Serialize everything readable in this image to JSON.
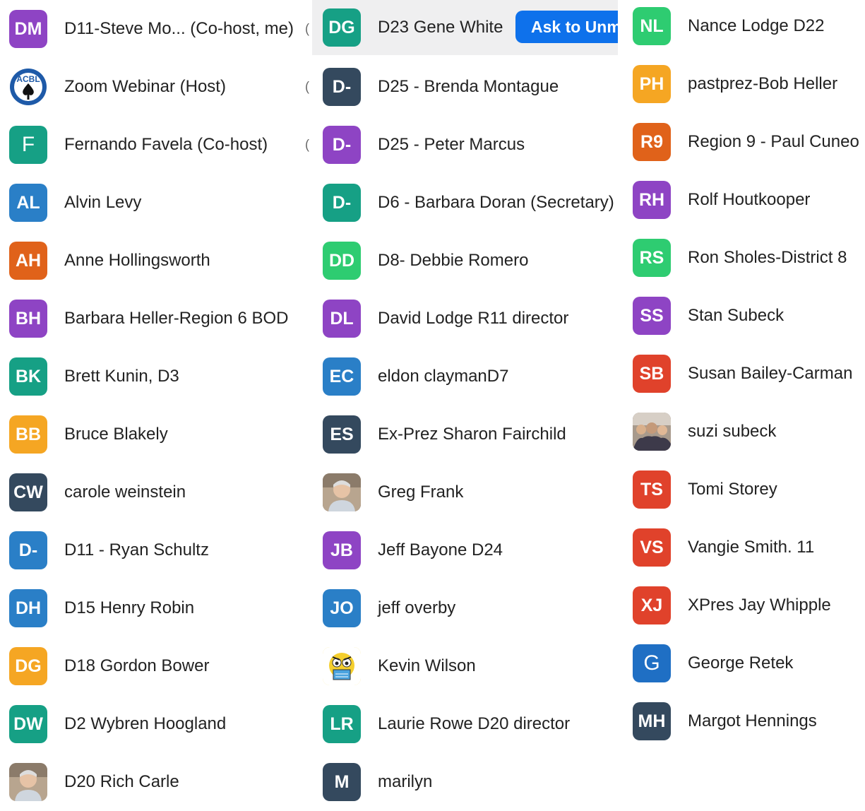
{
  "columns": [
    [
      {
        "initials": "DM",
        "name": "D11-Steve Mo... (Co-host, me)",
        "color": "#8e44c4",
        "trail": "("
      },
      {
        "initials": "",
        "name": "Zoom Webinar (Host)",
        "color": "#ffffff",
        "icon": "acbl-logo-icon",
        "trail": "("
      },
      {
        "initials": "F",
        "name": "Fernando Favela (Co-host)",
        "color": "#16a085",
        "thin": true,
        "trail": "("
      },
      {
        "initials": "AL",
        "name": "Alvin Levy",
        "color": "#2a7fc7"
      },
      {
        "initials": "AH",
        "name": "Anne Hollingsworth",
        "color": "#e0621a"
      },
      {
        "initials": "BH",
        "name": "Barbara Heller-Region 6 BOD",
        "color": "#8e44c4"
      },
      {
        "initials": "BK",
        "name": "Brett Kunin, D3",
        "color": "#16a085"
      },
      {
        "initials": "BB",
        "name": "Bruce Blakely",
        "color": "#f5a623"
      },
      {
        "initials": "CW",
        "name": "carole weinstein",
        "color": "#34495e"
      },
      {
        "initials": "D-",
        "name": "D11 - Ryan Schultz",
        "color": "#2a7fc7"
      },
      {
        "initials": "DH",
        "name": "D15 Henry Robin",
        "color": "#2a7fc7"
      },
      {
        "initials": "DG",
        "name": "D18 Gordon Bower",
        "color": "#f5a623"
      },
      {
        "initials": "DW",
        "name": "D2 Wybren Hoogland",
        "color": "#16a085"
      },
      {
        "initials": "",
        "name": "D20 Rich Carle",
        "color": "#cccccc",
        "icon": "user-photo-icon"
      }
    ],
    [
      {
        "initials": "DG",
        "name": "D23 Gene White",
        "color": "#16a085",
        "highlight": true,
        "button": "Ask to Unmute"
      },
      {
        "initials": "D-",
        "name": "D25 - Brenda Montague",
        "color": "#34495e"
      },
      {
        "initials": "D-",
        "name": "D25 - Peter Marcus",
        "color": "#8e44c4"
      },
      {
        "initials": "D-",
        "name": "D6 - Barbara Doran (Secretary)",
        "color": "#16a085"
      },
      {
        "initials": "DD",
        "name": "D8- Debbie Romero",
        "color": "#2ecc71"
      },
      {
        "initials": "DL",
        "name": "David Lodge R11 director",
        "color": "#8e44c4"
      },
      {
        "initials": "EC",
        "name": "eldon claymanD7",
        "color": "#2a7fc7"
      },
      {
        "initials": "ES",
        "name": "Ex-Prez Sharon Fairchild",
        "color": "#34495e"
      },
      {
        "initials": "",
        "name": "Greg Frank",
        "color": "#6b5a4a",
        "icon": "user-photo-icon"
      },
      {
        "initials": "JB",
        "name": "Jeff Bayone D24",
        "color": "#8e44c4"
      },
      {
        "initials": "JO",
        "name": "jeff overby",
        "color": "#2a7fc7"
      },
      {
        "initials": "",
        "name": "Kevin Wilson",
        "color": "#f7d13a",
        "icon": "cartoon-avatar-icon"
      },
      {
        "initials": "LR",
        "name": "Laurie Rowe D20 director",
        "color": "#16a085"
      },
      {
        "initials": "M",
        "name": "marilyn",
        "color": "#34495e"
      }
    ],
    [
      {
        "initials": "NL",
        "name": "Nance Lodge D22",
        "color": "#2ecc71"
      },
      {
        "initials": "PH",
        "name": "pastprez-Bob Heller",
        "color": "#f5a623"
      },
      {
        "initials": "R9",
        "name": "Region 9 - Paul Cuneo",
        "color": "#e0621a"
      },
      {
        "initials": "RH",
        "name": "Rolf Houtkooper",
        "color": "#8e44c4"
      },
      {
        "initials": "RS",
        "name": "Ron Sholes-District 8",
        "color": "#2ecc71"
      },
      {
        "initials": "SS",
        "name": "Stan Subeck",
        "color": "#8e44c4"
      },
      {
        "initials": "SB",
        "name": "Susan Bailey-Carman",
        "color": "#e0422b"
      },
      {
        "initials": "",
        "name": "suzi subeck",
        "color": "#7a6a5a",
        "icon": "group-photo-icon"
      },
      {
        "initials": "TS",
        "name": "Tomi Storey",
        "color": "#e0422b"
      },
      {
        "initials": "VS",
        "name": "Vangie Smith.  11",
        "color": "#e0422b"
      },
      {
        "initials": "XJ",
        "name": "XPres Jay Whipple",
        "color": "#e0422b"
      },
      {
        "initials": "G",
        "name": "George Retek",
        "color": "#1f6fc4",
        "thin": true
      },
      {
        "initials": "MH",
        "name": "Margot Hennings",
        "color": "#34495e"
      }
    ]
  ]
}
